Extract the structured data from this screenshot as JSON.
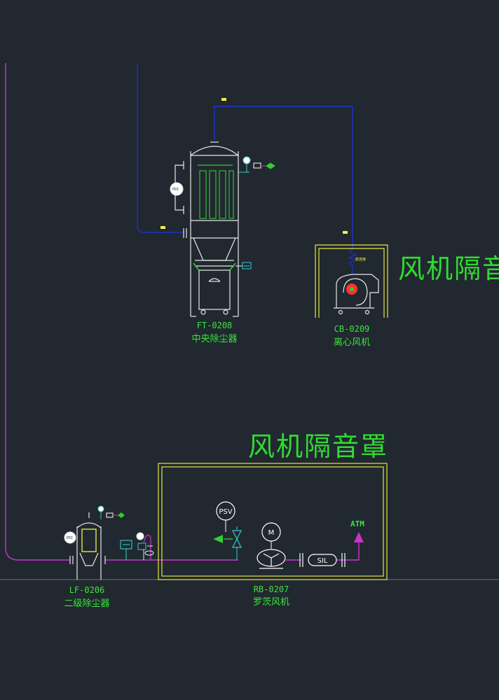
{
  "colors": {
    "background": "#212830",
    "equipment": "#e8e8e8",
    "process_line": "#cc33cc",
    "blue_line": "#1a33cc",
    "enclosure": "#e6e63c",
    "label": "#39e639",
    "filter_bags": "#33cc33",
    "instrument_cyan": "#33cccc",
    "red": "#ff3333"
  },
  "equipment": {
    "central_dust_collector": {
      "code": "FT-0208",
      "name": "中央除尘器"
    },
    "centrifugal_fan": {
      "code": "CB-0209",
      "name": "离心风机"
    },
    "secondary_dust_collector": {
      "code": "LF-0206",
      "name": "二级除尘器"
    },
    "roots_blower": {
      "code": "RB-0207",
      "name": "罗茨风机"
    }
  },
  "enclosures": {
    "centrifugal_fan_hood": "风机隔音罩",
    "roots_blower_hood": "风机隔音罩"
  },
  "components": {
    "psv": "PSV",
    "motor": "M",
    "silencer": "SIL",
    "atmosphere": "ATM"
  },
  "tiny_tags": {
    "top_pipe": "DN",
    "inlet_pipe": "DN",
    "fan_inlet": "DN",
    "flex_joint": "软连接"
  },
  "instrument_tags": {
    "dp_ft0208": "PDI",
    "dp_lf0206": "PDI",
    "pi_top": "PI",
    "pi_lf": "PI",
    "pi_line": "PI"
  },
  "icons": [
    "pressure-gauge-icon",
    "valve-icon",
    "motor-icon",
    "blower-icon",
    "psv-icon",
    "arrow-up-icon"
  ]
}
